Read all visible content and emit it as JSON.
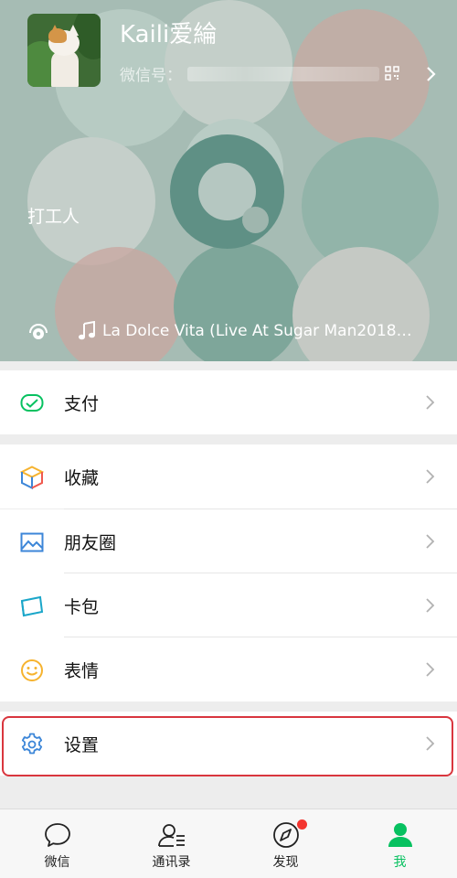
{
  "profile": {
    "nickname": "Kaili爱綸",
    "wechat_id_label": "微信号：",
    "status": "打工人",
    "now_playing": "La Dolce Vita (Live At Sugar Man20180…"
  },
  "menu": {
    "pay": "支付",
    "favorites": "收藏",
    "moments": "朋友圈",
    "cards": "卡包",
    "stickers": "表情",
    "settings": "设置"
  },
  "tabs": [
    {
      "label": "微信",
      "icon": "chat-bubble-icon"
    },
    {
      "label": "通讯录",
      "icon": "contacts-icon"
    },
    {
      "label": "发现",
      "icon": "compass-icon"
    },
    {
      "label": "我",
      "icon": "me-icon"
    }
  ],
  "colors": {
    "accent": "#07c160",
    "highlight_border": "#d9363e",
    "badge": "#f43530"
  }
}
